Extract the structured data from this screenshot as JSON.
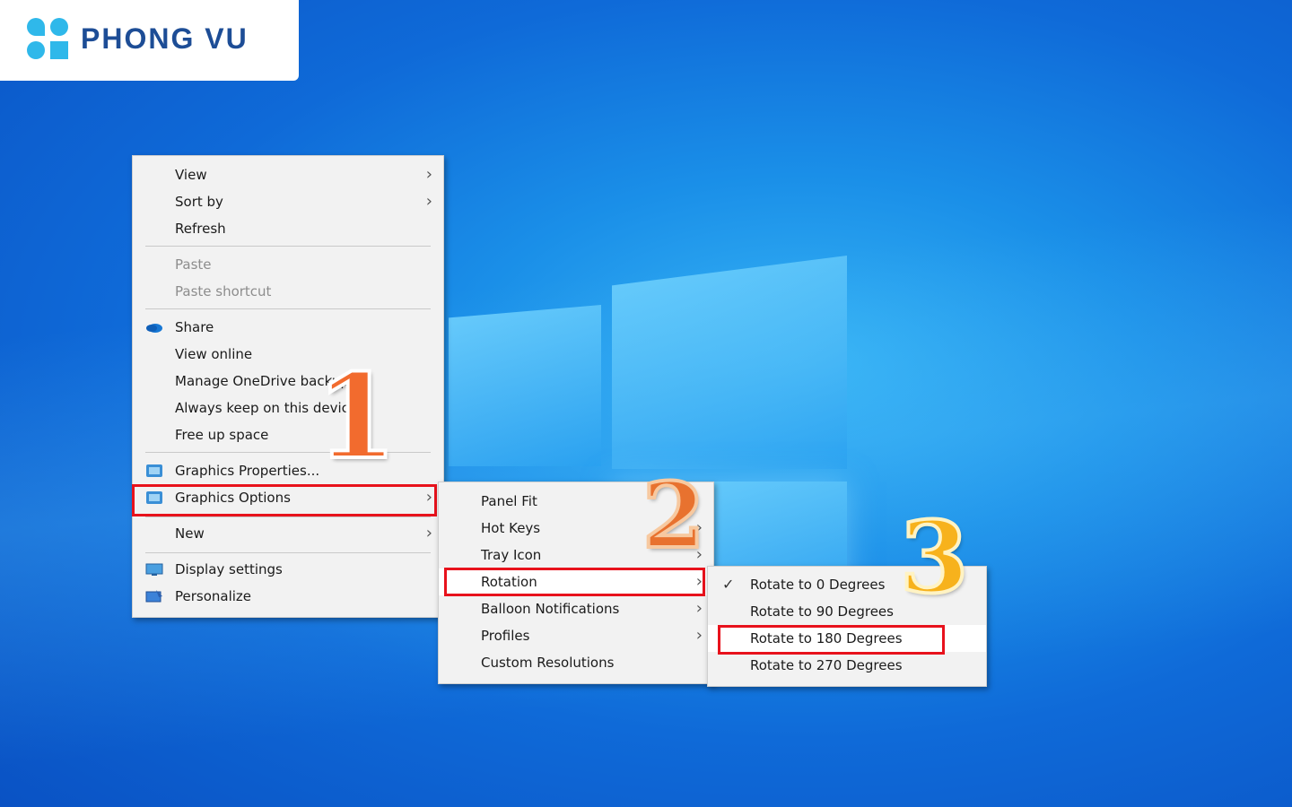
{
  "brand": {
    "name": "PHONG VU"
  },
  "context_menu": {
    "items": [
      {
        "label": "View",
        "submenu": true
      },
      {
        "label": "Sort by",
        "submenu": true
      },
      {
        "label": "Refresh"
      },
      {
        "label": "Paste",
        "disabled": true
      },
      {
        "label": "Paste shortcut",
        "disabled": true
      },
      {
        "label": "Share",
        "icon": "onedrive-cloud-icon"
      },
      {
        "label": "View online"
      },
      {
        "label": "Manage OneDrive backup"
      },
      {
        "label": "Always keep on this device"
      },
      {
        "label": "Free up space"
      },
      {
        "label": "Graphics Properties...",
        "icon": "intel-graphics-icon"
      },
      {
        "label": "Graphics Options",
        "icon": "intel-graphics-icon",
        "submenu": true,
        "highlighted": true
      },
      {
        "label": "New",
        "submenu": true
      },
      {
        "label": "Display settings",
        "icon": "display-icon"
      },
      {
        "label": "Personalize",
        "icon": "personalize-icon"
      }
    ]
  },
  "graphics_submenu": {
    "items": [
      {
        "label": "Panel Fit"
      },
      {
        "label": "Hot Keys",
        "submenu": true
      },
      {
        "label": "Tray Icon",
        "submenu": true
      },
      {
        "label": "Rotation",
        "submenu": true,
        "highlighted": true
      },
      {
        "label": "Balloon Notifications",
        "submenu": true
      },
      {
        "label": "Profiles",
        "submenu": true
      },
      {
        "label": "Custom Resolutions"
      }
    ]
  },
  "rotation_submenu": {
    "items": [
      {
        "label": "Rotate to 0 Degrees",
        "checked": true
      },
      {
        "label": "Rotate to 90 Degrees"
      },
      {
        "label": "Rotate to 180 Degrees",
        "highlighted": true
      },
      {
        "label": "Rotate to 270 Degrees"
      }
    ]
  },
  "step_badges": [
    "1",
    "2",
    "3"
  ],
  "colors": {
    "highlight_box": "#e8121c",
    "badge_1": "#f26b2e",
    "badge_2": "#e8722f",
    "badge_3": "#f7b21c",
    "brand_blue": "#1d4d96",
    "brand_cyan": "#2fb8ea"
  }
}
